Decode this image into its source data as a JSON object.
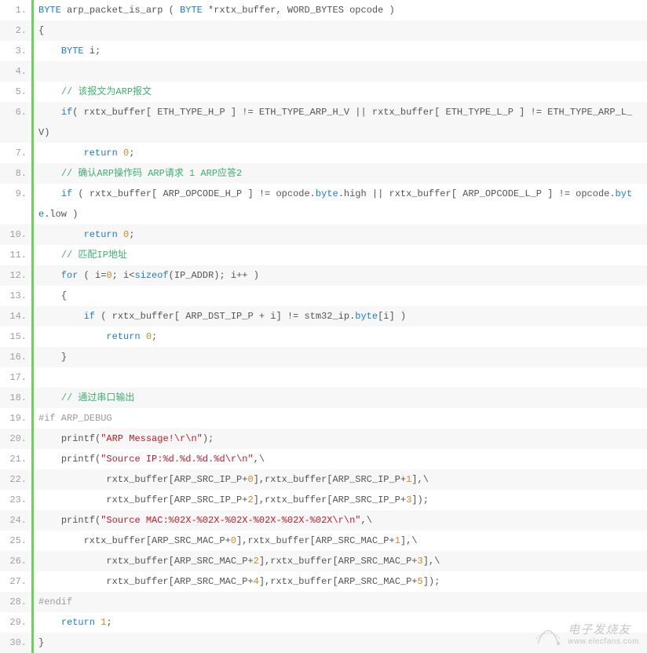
{
  "lines": [
    {
      "n": "1.",
      "tokens": [
        {
          "t": "BYTE",
          "c": "tok-type"
        },
        {
          "t": " arp_packet_is_arp ( ",
          "c": "tok-id"
        },
        {
          "t": "BYTE",
          "c": "tok-type"
        },
        {
          "t": " *rxtx_buffer, WORD_BYTES opcode )",
          "c": "tok-id"
        }
      ]
    },
    {
      "n": "2.",
      "tokens": [
        {
          "t": "{",
          "c": "tok-op"
        }
      ]
    },
    {
      "n": "3.",
      "tokens": [
        {
          "t": "    ",
          "c": ""
        },
        {
          "t": "BYTE",
          "c": "tok-type"
        },
        {
          "t": " i;",
          "c": "tok-id"
        }
      ]
    },
    {
      "n": "4.",
      "tokens": [
        {
          "t": " ",
          "c": ""
        }
      ]
    },
    {
      "n": "5.",
      "tokens": [
        {
          "t": "    ",
          "c": ""
        },
        {
          "t": "// 该报文为ARP报文",
          "c": "tok-comm"
        }
      ]
    },
    {
      "n": "6.",
      "tokens": [
        {
          "t": "    ",
          "c": ""
        },
        {
          "t": "if",
          "c": "tok-key"
        },
        {
          "t": "( rxtx_buffer[ ETH_TYPE_H_P ] != ETH_TYPE_ARP_H_V || rxtx_buffer[ ETH_TYPE_L_P ] != ETH_TYPE_ARP_L_V)",
          "c": "tok-id"
        }
      ]
    },
    {
      "n": "7.",
      "tokens": [
        {
          "t": "        ",
          "c": ""
        },
        {
          "t": "return",
          "c": "tok-key"
        },
        {
          "t": " ",
          "c": ""
        },
        {
          "t": "0",
          "c": "tok-num"
        },
        {
          "t": ";",
          "c": "tok-op"
        }
      ]
    },
    {
      "n": "8.",
      "tokens": [
        {
          "t": "    ",
          "c": ""
        },
        {
          "t": "// 确认ARP操作码 ARP请求 1 ARP应答2",
          "c": "tok-comm"
        }
      ]
    },
    {
      "n": "9.",
      "tokens": [
        {
          "t": "    ",
          "c": ""
        },
        {
          "t": "if",
          "c": "tok-key"
        },
        {
          "t": " ( rxtx_buffer[ ARP_OPCODE_H_P ] != opcode.",
          "c": "tok-id"
        },
        {
          "t": "byte",
          "c": "tok-type"
        },
        {
          "t": ".high || rxtx_buffer[ ARP_OPCODE_L_P ] != opcode.",
          "c": "tok-id"
        },
        {
          "t": "byte",
          "c": "tok-type"
        },
        {
          "t": ".low )",
          "c": "tok-id"
        }
      ]
    },
    {
      "n": "10.",
      "tokens": [
        {
          "t": "        ",
          "c": ""
        },
        {
          "t": "return",
          "c": "tok-key"
        },
        {
          "t": " ",
          "c": ""
        },
        {
          "t": "0",
          "c": "tok-num"
        },
        {
          "t": ";",
          "c": "tok-op"
        }
      ]
    },
    {
      "n": "11.",
      "tokens": [
        {
          "t": "    ",
          "c": ""
        },
        {
          "t": "// 匹配IP地址",
          "c": "tok-comm"
        }
      ]
    },
    {
      "n": "12.",
      "tokens": [
        {
          "t": "    ",
          "c": ""
        },
        {
          "t": "for",
          "c": "tok-key"
        },
        {
          "t": " ( i=",
          "c": "tok-id"
        },
        {
          "t": "0",
          "c": "tok-num"
        },
        {
          "t": "; i<",
          "c": "tok-id"
        },
        {
          "t": "sizeof",
          "c": "tok-key"
        },
        {
          "t": "(IP_ADDR); i++ )",
          "c": "tok-id"
        }
      ]
    },
    {
      "n": "13.",
      "tokens": [
        {
          "t": "    {",
          "c": "tok-op"
        }
      ]
    },
    {
      "n": "14.",
      "tokens": [
        {
          "t": "        ",
          "c": ""
        },
        {
          "t": "if",
          "c": "tok-key"
        },
        {
          "t": " ( rxtx_buffer[ ARP_DST_IP_P + i] != stm32_ip.",
          "c": "tok-id"
        },
        {
          "t": "byte",
          "c": "tok-type"
        },
        {
          "t": "[i] )",
          "c": "tok-id"
        }
      ]
    },
    {
      "n": "15.",
      "tokens": [
        {
          "t": "            ",
          "c": ""
        },
        {
          "t": "return",
          "c": "tok-key"
        },
        {
          "t": " ",
          "c": ""
        },
        {
          "t": "0",
          "c": "tok-num"
        },
        {
          "t": ";",
          "c": "tok-op"
        }
      ]
    },
    {
      "n": "16.",
      "tokens": [
        {
          "t": "    }",
          "c": "tok-op"
        }
      ]
    },
    {
      "n": "17.",
      "tokens": [
        {
          "t": " ",
          "c": ""
        }
      ]
    },
    {
      "n": "18.",
      "tokens": [
        {
          "t": "    ",
          "c": ""
        },
        {
          "t": "// 通过串口输出",
          "c": "tok-comm"
        }
      ]
    },
    {
      "n": "19.",
      "tokens": [
        {
          "t": "#if ARP_DEBUG",
          "c": "tok-pp"
        }
      ]
    },
    {
      "n": "20.",
      "tokens": [
        {
          "t": "    printf(",
          "c": "tok-id"
        },
        {
          "t": "\"ARP Message!\\r\\n\"",
          "c": "tok-str"
        },
        {
          "t": ");",
          "c": "tok-op"
        }
      ]
    },
    {
      "n": "21.",
      "tokens": [
        {
          "t": "    printf(",
          "c": "tok-id"
        },
        {
          "t": "\"Source IP:%d.%d.%d.%d\\r\\n\"",
          "c": "tok-str"
        },
        {
          "t": ",\\",
          "c": "tok-op"
        }
      ]
    },
    {
      "n": "22.",
      "tokens": [
        {
          "t": "            rxtx_buffer[ARP_SRC_IP_P+",
          "c": "tok-id"
        },
        {
          "t": "0",
          "c": "tok-num"
        },
        {
          "t": "],rxtx_buffer[ARP_SRC_IP_P+",
          "c": "tok-id"
        },
        {
          "t": "1",
          "c": "tok-num"
        },
        {
          "t": "],\\",
          "c": "tok-op"
        }
      ]
    },
    {
      "n": "23.",
      "tokens": [
        {
          "t": "            rxtx_buffer[ARP_SRC_IP_P+",
          "c": "tok-id"
        },
        {
          "t": "2",
          "c": "tok-num"
        },
        {
          "t": "],rxtx_buffer[ARP_SRC_IP_P+",
          "c": "tok-id"
        },
        {
          "t": "3",
          "c": "tok-num"
        },
        {
          "t": "]);",
          "c": "tok-op"
        }
      ]
    },
    {
      "n": "24.",
      "tokens": [
        {
          "t": "    printf(",
          "c": "tok-id"
        },
        {
          "t": "\"Source MAC:%02X-%02X-%02X-%02X-%02X-%02X\\r\\n\"",
          "c": "tok-str"
        },
        {
          "t": ",\\",
          "c": "tok-op"
        }
      ]
    },
    {
      "n": "25.",
      "tokens": [
        {
          "t": "        rxtx_buffer[ARP_SRC_MAC_P+",
          "c": "tok-id"
        },
        {
          "t": "0",
          "c": "tok-num"
        },
        {
          "t": "],rxtx_buffer[ARP_SRC_MAC_P+",
          "c": "tok-id"
        },
        {
          "t": "1",
          "c": "tok-num"
        },
        {
          "t": "],\\",
          "c": "tok-op"
        }
      ]
    },
    {
      "n": "26.",
      "tokens": [
        {
          "t": "            rxtx_buffer[ARP_SRC_MAC_P+",
          "c": "tok-id"
        },
        {
          "t": "2",
          "c": "tok-num"
        },
        {
          "t": "],rxtx_buffer[ARP_SRC_MAC_P+",
          "c": "tok-id"
        },
        {
          "t": "3",
          "c": "tok-num"
        },
        {
          "t": "],\\",
          "c": "tok-op"
        }
      ]
    },
    {
      "n": "27.",
      "tokens": [
        {
          "t": "            rxtx_buffer[ARP_SRC_MAC_P+",
          "c": "tok-id"
        },
        {
          "t": "4",
          "c": "tok-num"
        },
        {
          "t": "],rxtx_buffer[ARP_SRC_MAC_P+",
          "c": "tok-id"
        },
        {
          "t": "5",
          "c": "tok-num"
        },
        {
          "t": "]);",
          "c": "tok-op"
        }
      ]
    },
    {
      "n": "28.",
      "tokens": [
        {
          "t": "#endif",
          "c": "tok-pp"
        }
      ]
    },
    {
      "n": "29.",
      "tokens": [
        {
          "t": "    ",
          "c": ""
        },
        {
          "t": "return",
          "c": "tok-key"
        },
        {
          "t": " ",
          "c": ""
        },
        {
          "t": "1",
          "c": "tok-num"
        },
        {
          "t": ";",
          "c": "tok-op"
        }
      ]
    },
    {
      "n": "30.",
      "tokens": [
        {
          "t": "}",
          "c": "tok-op"
        }
      ]
    }
  ],
  "watermark": {
    "cn": "电子发烧友",
    "en": "www.elecfans.com"
  }
}
